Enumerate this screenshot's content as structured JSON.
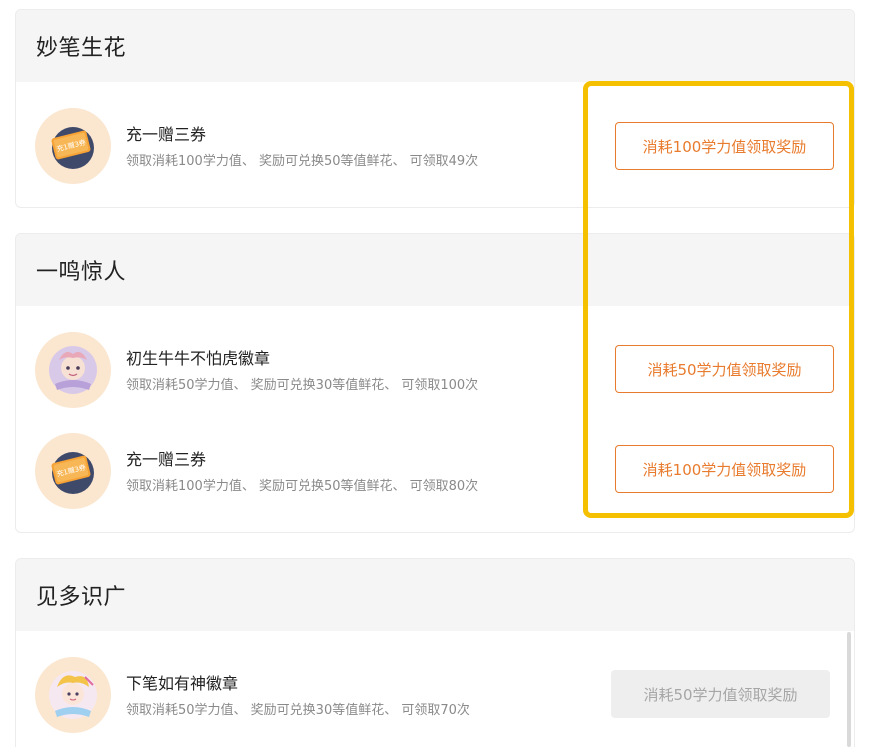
{
  "sections": [
    {
      "title": "妙笔生花",
      "items": [
        {
          "icon": "ticket-coupon-icon",
          "title": "充一赠三券",
          "desc": "领取消耗100学力值、 奖励可兑换50等值鲜花、 可领取49次",
          "button": "消耗100学力值领取奖励",
          "enabled": true,
          "ticket_text": "充1赠3券"
        }
      ]
    },
    {
      "title": "一鸣惊人",
      "items": [
        {
          "icon": "cow-badge-icon",
          "title": "初生牛牛不怕虎徽章",
          "desc": "领取消耗50学力值、 奖励可兑换30等值鲜花、 可领取100次",
          "button": "消耗50学力值领取奖励",
          "enabled": true
        },
        {
          "icon": "ticket-coupon-icon",
          "title": "充一赠三券",
          "desc": "领取消耗100学力值、 奖励可兑换50等值鲜花、 可领取80次",
          "button": "消耗100学力值领取奖励",
          "enabled": true,
          "ticket_text": "充1赠3券"
        }
      ]
    },
    {
      "title": "见多识广",
      "items": [
        {
          "icon": "pen-badge-icon",
          "title": "下笔如有神徽章",
          "desc": "领取消耗50学力值、 奖励可兑换30等值鲜花、 可领取70次",
          "button": "消耗50学力值领取奖励",
          "enabled": false
        }
      ]
    }
  ],
  "colors": {
    "accent": "#e87b2d",
    "highlight": "#f5c000",
    "avatar_bg": "#fbe6cf",
    "disabled_bg": "#eeeeee"
  }
}
